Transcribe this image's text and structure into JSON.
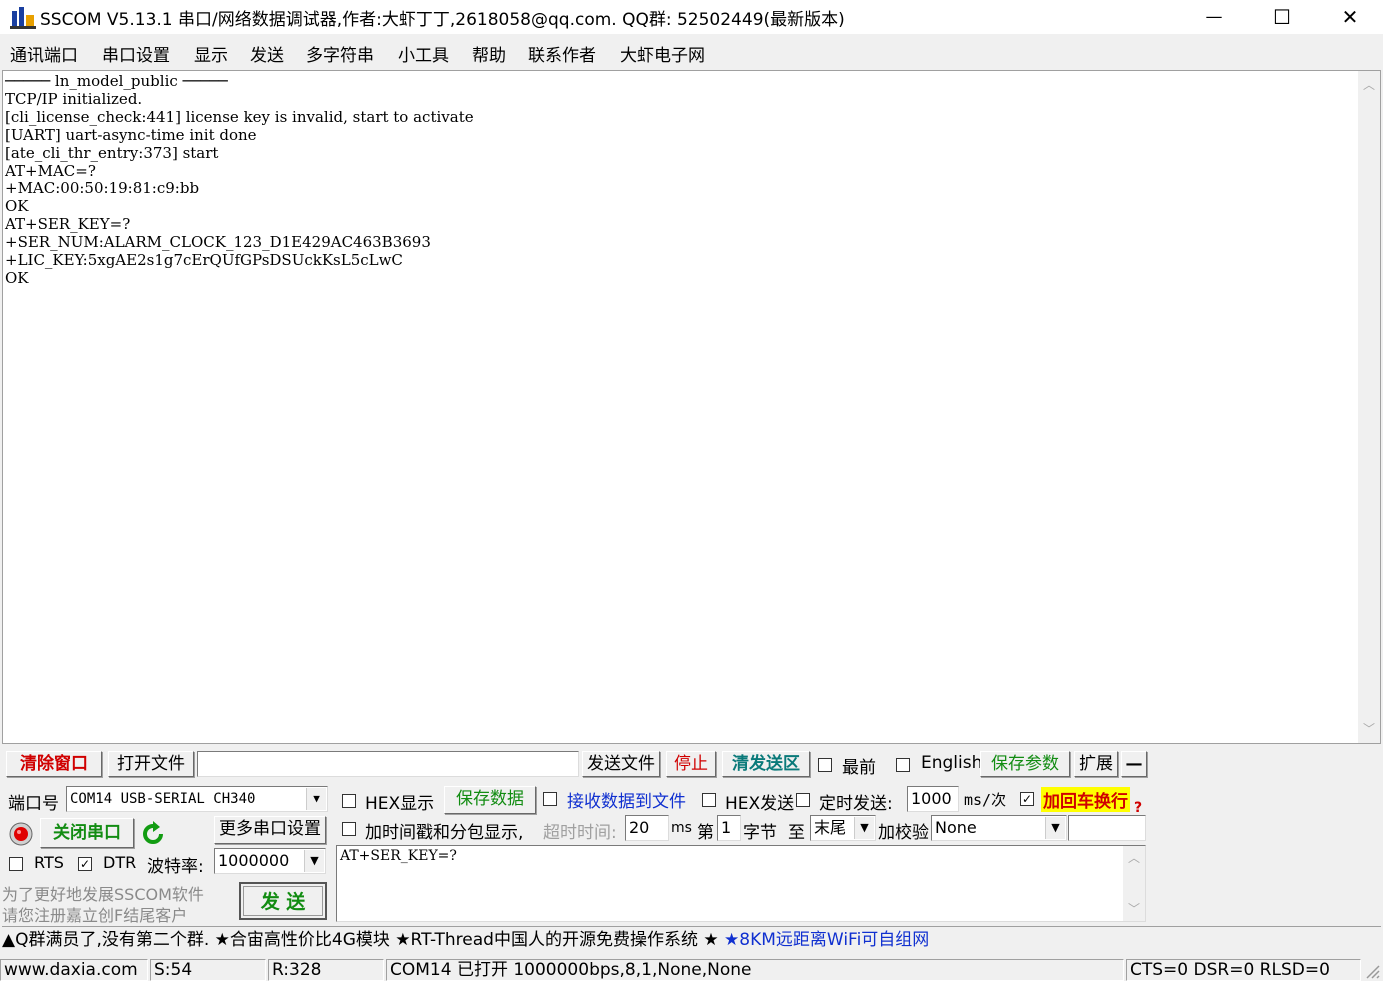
{
  "window": {
    "title": "SSCOM V5.13.1 串口/网络数据调试器,作者:大虾丁丁,2618058@qq.com. QQ群: 52502449(最新版本)",
    "minimize": "—",
    "maximize": "☐",
    "close": "✕"
  },
  "menu": [
    "通讯端口",
    "串口设置",
    "显示",
    "发送",
    "多字符串",
    "小工具",
    "帮助",
    "联系作者",
    "大虾电子网"
  ],
  "receive_text": "───── ln_model_public ─────\nTCP/IP initialized.\n[cli_license_check:441] license key is invalid, start to activate\n[UART] uart-async-time init done\n[ate_cli_thr_entry:373] start\nAT+MAC=?\n+MAC:00:50:19:81:c9:bb\nOK\nAT+SER_KEY=?\n+SER_NUM:ALARM_CLOCK_123_D1E429AC463B3693\n+LIC_KEY:5xgAE2s1g7cErQUfGPsDSUckKsL5cLwC\nOK",
  "toolbar": {
    "clear_window": "清除窗口",
    "open_file": "打开文件",
    "file_path": "",
    "send_file": "发送文件",
    "stop": "停止",
    "clear_send": "清发送区",
    "topmost": "最前",
    "english": "English",
    "save_params": "保存参数",
    "expand": "扩展",
    "collapse": "—"
  },
  "port": {
    "port_label": "端口号",
    "port_value": "COM14 USB-SERIAL CH340",
    "close_port": "关闭串口",
    "more_settings": "更多串口设置",
    "rts": "RTS",
    "dtr": "DTR",
    "baud_label": "波特率:",
    "baud_value": "1000000",
    "promo_line1": "为了更好地发展SSCOM软件",
    "promo_line2": "请您注册嘉立创F结尾客户",
    "send": "发  送"
  },
  "options": {
    "hex_display": "HEX显示",
    "save_data": "保存数据",
    "recv_to_file": "接收数据到文件",
    "hex_send": "HEX发送",
    "timed_send": "定时发送:",
    "interval": "1000",
    "interval_unit": "ms/次",
    "append_crlf": "加回车换行",
    "help_mark": "?",
    "timestamp": "加时间戳和分包显示,",
    "timeout_label": "超时时间:",
    "timeout": "20",
    "ms": "ms",
    "nth": "第",
    "byte_start": "1",
    "byte_label": "字节",
    "to": "至",
    "end_value": "末尾",
    "checksum_label": "加校验",
    "checksum_value": "None",
    "send_input": "AT+SER_KEY=?"
  },
  "ticker": {
    "part1": "▲Q群满员了,没有第二个群. ★合宙高性价比4G模块 ★RT-Thread中国人的开源免费操作系统 ★ ",
    "part2": "★8KM远距离WiFi可自组网"
  },
  "status": {
    "website": "www.daxia.com",
    "sent": "S:54",
    "received": "R:328",
    "port_status": "COM14 已打开  1000000bps,8,1,None,None",
    "lines": "CTS=0 DSR=0 RLSD=0"
  },
  "colors": {
    "accent_red": "#d00000",
    "accent_green": "#128c12",
    "accent_blue": "#1030d0",
    "highlight_yellow": "#ffff00"
  }
}
